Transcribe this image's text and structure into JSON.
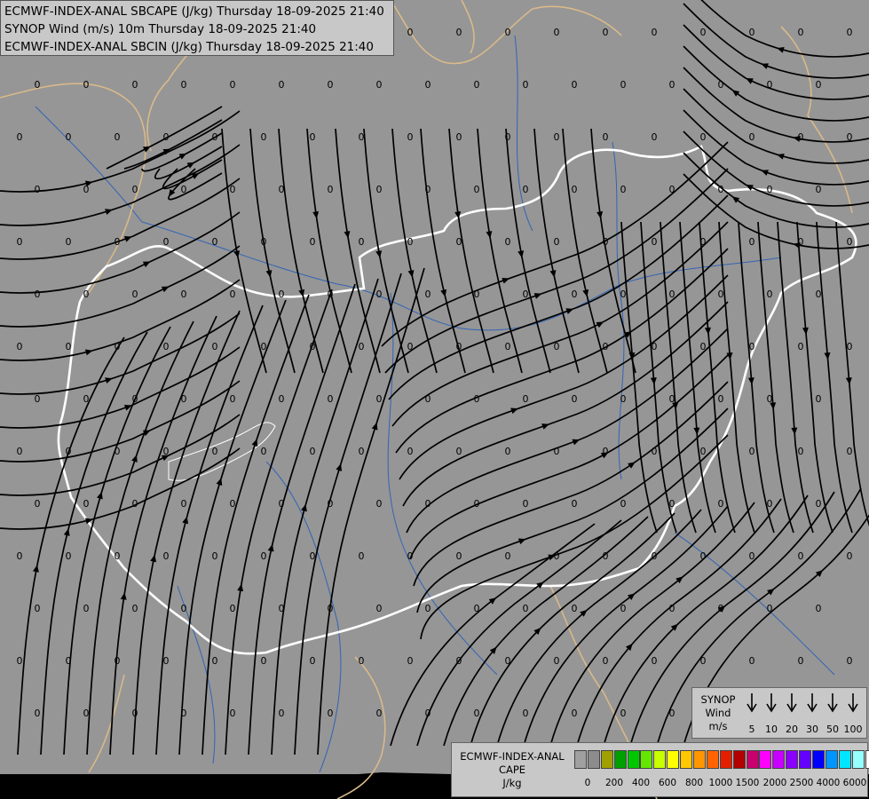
{
  "title_lines": [
    "ECMWF-INDEX-ANAL SBCAPE (J/kg) Thursday 18-09-2025 21:40",
    "SYNOP Wind (m/s) 10m Thursday 18-09-2025 21:40",
    "ECMWF-INDEX-ANAL SBCIN (J/kg) Thursday 18-09-2025 21:40"
  ],
  "field_value_label": "0",
  "wind_legend": {
    "title": [
      "SYNOP",
      "Wind",
      "m/s"
    ],
    "speeds": [
      "5",
      "10",
      "20",
      "30",
      "50",
      "100"
    ]
  },
  "cape_legend": {
    "title": [
      "ECMWF-INDEX-ANAL",
      "CAPE",
      "J/kg"
    ],
    "colors": [
      "#a0a0a0",
      "#8c8c8c",
      "#a0a000",
      "#00a000",
      "#00c800",
      "#64e600",
      "#c8ff00",
      "#ffff00",
      "#ffc800",
      "#ff9600",
      "#ff6400",
      "#e61e00",
      "#b40000",
      "#c8006e",
      "#ff00ff",
      "#c800ff",
      "#8c00ff",
      "#6400ff",
      "#0000ff",
      "#0096ff",
      "#00e6ff",
      "#96ffff",
      "#ffffff"
    ],
    "ticks": [
      "0",
      "200",
      "400",
      "600",
      "800",
      "1000",
      "1500",
      "2000",
      "2500",
      "4000",
      "6000"
    ]
  },
  "colors": {
    "background": "#969696",
    "borders": "#ffffff",
    "neighbour_borders": "#e0c090",
    "rivers": "#3264b4",
    "streamlines": "#000000"
  }
}
